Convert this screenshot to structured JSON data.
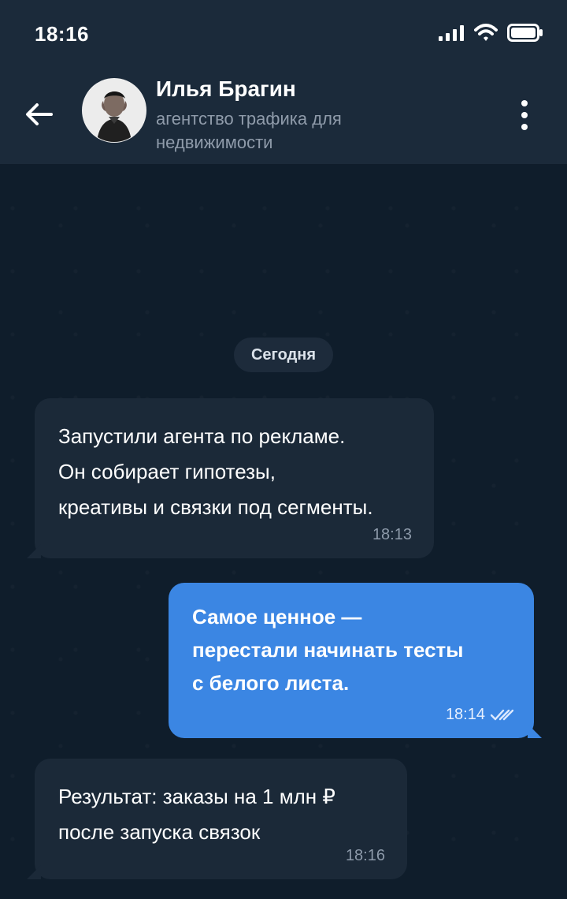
{
  "status_bar": {
    "time": "18:16",
    "icons": [
      "signal-bars-icon",
      "wifi-icon",
      "battery-icon"
    ]
  },
  "header": {
    "back_icon": "arrow-left-icon",
    "avatar_icon": "person-photo",
    "title": "Илья Брагин",
    "subtitle": "агентство трафика для недвижимости",
    "menu_icon": "vertical-ellipsis-icon"
  },
  "chat": {
    "date_label": "Сегодня",
    "messages": [
      {
        "direction": "incoming",
        "lines": [
          "Запустили агента по рекламе.",
          "Он собирает гипотезы,",
          "креативы и связки под сегменты."
        ],
        "time": "18:13"
      },
      {
        "direction": "outgoing",
        "lines": [
          "Самое ценное —",
          "перестали начинать тесты",
          "с белого листа."
        ],
        "time": "18:14",
        "status_icon": "double-check-icon"
      },
      {
        "direction": "incoming",
        "lines": [
          "Результат: заказы на 1 млн ₽",
          "после запуска связок"
        ],
        "time": "18:16"
      }
    ]
  },
  "colors": {
    "header_background": "#1b2a3a",
    "chat_background": "#0f1d2b",
    "incoming_bubble": "#1b2938",
    "outgoing_bubble": "#3b86e3"
  }
}
